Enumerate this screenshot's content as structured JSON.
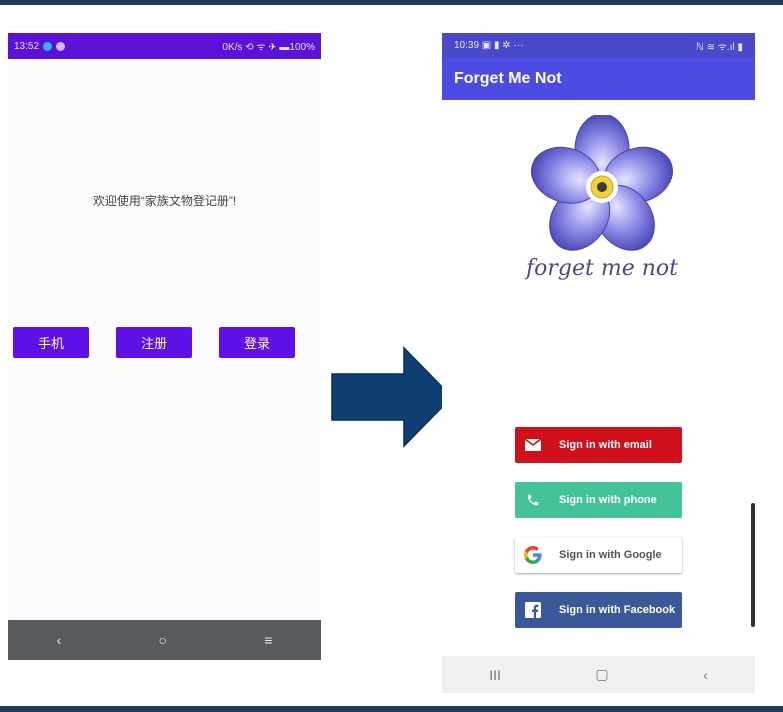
{
  "left_phone": {
    "status": {
      "time": "13:52",
      "right": "0K/s ⟲ ᯤ ✈ ▬100%"
    },
    "welcome_text": "欢迎使用“家族文物登记册”!",
    "buttons": {
      "phone": "手机",
      "register": "注册",
      "login": "登录"
    },
    "nav": {
      "back": "‹",
      "home": "○",
      "menu": "≡"
    }
  },
  "right_phone": {
    "status": {
      "time": "10:39 ▣ ▮ ✲ ···",
      "right": "ℕ ≋ ᯤ.ıl ▮"
    },
    "app_title": "Forget Me Not",
    "logo_text": "forget me not",
    "buttons": {
      "email": "Sign in with email",
      "phone": "Sign in with phone",
      "google": "Sign in with Google",
      "facebook": "Sign in with Facebook"
    },
    "nav": {
      "recent": "III",
      "home": "▢",
      "back": "‹"
    }
  },
  "colors": {
    "frame": "#1f3a5f",
    "left_accent": "#5f10e6",
    "right_appbar": "#4c4be2",
    "email": "#d0101b",
    "phone": "#44c39b",
    "facebook": "#3b5998",
    "arrow": "#0f3f73"
  }
}
